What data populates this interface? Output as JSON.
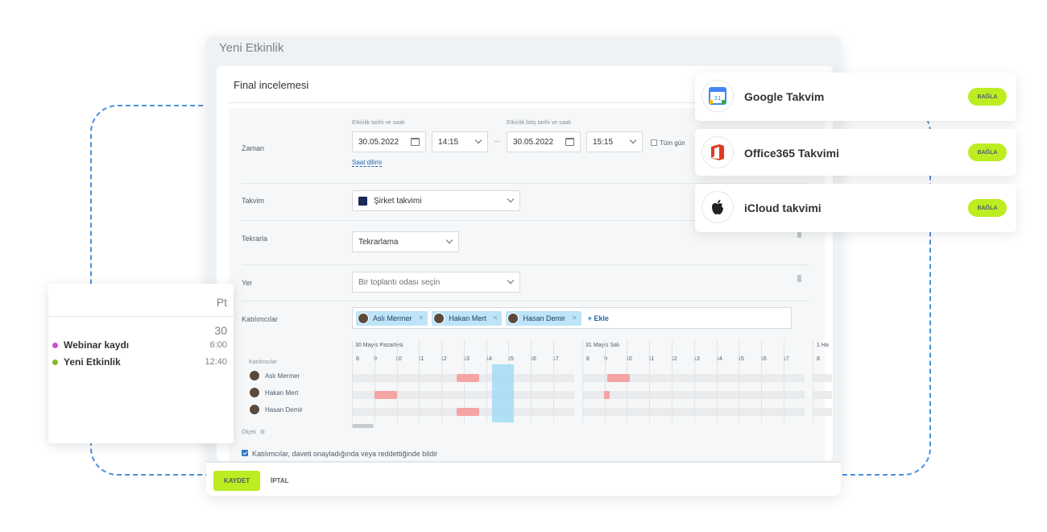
{
  "dialog": {
    "title": "Yeni Etkinlik",
    "event_name": "Final incelemesi",
    "zaman": {
      "label": "Zaman",
      "start_caption": "Etkinlik tarihi ve saati",
      "end_caption": "Etkinlik bitiş tarihi ve saati",
      "start_date": "30.05.2022",
      "start_time": "14:15",
      "end_date": "30.05.2022",
      "end_time": "15:15",
      "separator": "--",
      "all_day": "Tüm gün",
      "timezone_link": "Saat dilimi"
    },
    "takvim": {
      "label": "Takvim",
      "value": "Şirket takvimi",
      "swatch_color": "#1a2b5a"
    },
    "tekrarla": {
      "label": "Tekrarla",
      "value": "Tekrarlama"
    },
    "yer": {
      "label": "Yer",
      "placeholder": "Bir toplantı odası seçin"
    },
    "katilimcilar": {
      "label": "Katılımcılar",
      "chips": [
        "Aslı Mermer",
        "Hakan Mert",
        "Hasan Demir"
      ],
      "add_label": "+ Ekle"
    },
    "timeline": {
      "column_label": "Katılımcılar",
      "day1": "30 Mayıs Pazartesi",
      "day2": "31 Mayıs Salı",
      "day3": "1 Ha",
      "hours": [
        "8",
        "9",
        "10",
        "11",
        "12",
        "13",
        "14",
        "15",
        "16",
        "17"
      ],
      "people": [
        "Aslı Mermer",
        "Hakan Mert",
        "Hasan Demir"
      ],
      "scale_label": "Ölçek"
    },
    "notify_label": "Katılımcılar, daveti onayladığında veya reddettiğinde bildir",
    "save_label": "KAYDET",
    "cancel_label": "İPTAL"
  },
  "integrations": [
    {
      "name": "Google Takvim",
      "button": "BAĞLA",
      "icon": "google-calendar-icon"
    },
    {
      "name": "Office365 Takvimi",
      "button": "BAĞLA",
      "icon": "office365-icon"
    },
    {
      "name": "iCloud takvimi",
      "button": "BAĞLA",
      "icon": "apple-icon"
    }
  ],
  "agenda": {
    "day": "Pt",
    "date": "30",
    "items": [
      {
        "title": "Webinar kaydı",
        "time": "6:00",
        "color": "#c94fd1"
      },
      {
        "title": "Yeni Etkinlik",
        "time": "12:40",
        "color": "#8ab82a"
      }
    ]
  },
  "colors": {
    "accent_green": "#bbed21",
    "link_blue": "#2067b0",
    "busy_red": "#f5a3a3",
    "now_blue": "#a7ddf5"
  }
}
